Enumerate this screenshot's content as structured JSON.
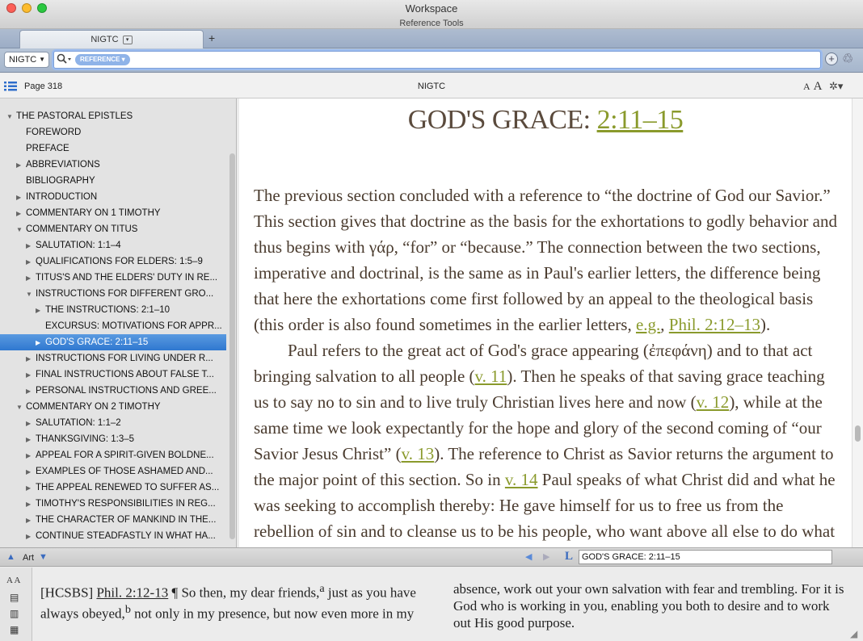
{
  "window": {
    "title": "Workspace",
    "subtitle": "Reference Tools"
  },
  "colors": {
    "accent": "#8a9a2c",
    "heading": "#5a4a3c",
    "selection": "#3b82d6"
  },
  "tab": {
    "label": "NIGTC",
    "menu_glyph": "▾",
    "add_glyph": "+"
  },
  "toolbar": {
    "resource": "NIGTC",
    "reference_pill": "REFERENCE ▾",
    "search_value": ""
  },
  "content_header": {
    "page": "Page 318",
    "resource_title": "NIGTC",
    "font_small": "A",
    "font_large": "A"
  },
  "toc": {
    "items": [
      {
        "label": "THE PASTORAL EPISTLES",
        "expander": "▼",
        "depth": 0
      },
      {
        "label": "FOREWORD",
        "expander": "",
        "depth": 1
      },
      {
        "label": "PREFACE",
        "expander": "",
        "depth": 1
      },
      {
        "label": "ABBREVIATIONS",
        "expander": "▶",
        "depth": 1
      },
      {
        "label": "BIBLIOGRAPHY",
        "expander": "",
        "depth": 1
      },
      {
        "label": "INTRODUCTION",
        "expander": "▶",
        "depth": 1
      },
      {
        "label": "COMMENTARY ON 1 TIMOTHY",
        "expander": "▶",
        "depth": 1
      },
      {
        "label": "COMMENTARY ON TITUS",
        "expander": "▼",
        "depth": 1
      },
      {
        "label": "SALUTATION: 1:1–4",
        "expander": "▶",
        "depth": 2
      },
      {
        "label": "QUALIFICATIONS FOR ELDERS: 1:5–9",
        "expander": "▶",
        "depth": 2
      },
      {
        "label": "TITUS'S AND THE ELDERS' DUTY IN RE...",
        "expander": "▶",
        "depth": 2
      },
      {
        "label": "INSTRUCTIONS FOR DIFFERENT GRO...",
        "expander": "▼",
        "depth": 2
      },
      {
        "label": "THE INSTRUCTIONS: 2:1–10",
        "expander": "▶",
        "depth": 3
      },
      {
        "label": "EXCURSUS: MOTIVATIONS FOR APPR...",
        "expander": "",
        "depth": 3
      },
      {
        "label": "GOD'S GRACE: 2:11–15",
        "expander": "▶",
        "depth": 3,
        "selected": true
      },
      {
        "label": "INSTRUCTIONS FOR LIVING UNDER R...",
        "expander": "▶",
        "depth": 2
      },
      {
        "label": "FINAL INSTRUCTIONS ABOUT FALSE T...",
        "expander": "▶",
        "depth": 2
      },
      {
        "label": "PERSONAL INSTRUCTIONS AND GREE...",
        "expander": "▶",
        "depth": 2
      },
      {
        "label": "COMMENTARY ON 2 TIMOTHY",
        "expander": "▼",
        "depth": 1
      },
      {
        "label": "SALUTATION: 1:1–2",
        "expander": "▶",
        "depth": 2
      },
      {
        "label": "THANKSGIVING: 1:3–5",
        "expander": "▶",
        "depth": 2
      },
      {
        "label": "APPEAL FOR A SPIRIT-GIVEN BOLDNE...",
        "expander": "▶",
        "depth": 2
      },
      {
        "label": "EXAMPLES OF THOSE ASHAMED AND...",
        "expander": "▶",
        "depth": 2
      },
      {
        "label": "THE APPEAL RENEWED TO SUFFER AS...",
        "expander": "▶",
        "depth": 2
      },
      {
        "label": "TIMOTHY'S RESPONSIBILITIES IN REG...",
        "expander": "▶",
        "depth": 2
      },
      {
        "label": "THE CHARACTER OF MANKIND IN THE...",
        "expander": "▶",
        "depth": 2
      },
      {
        "label": "CONTINUE STEADFASTLY IN WHAT HA...",
        "expander": "▶",
        "depth": 2
      }
    ]
  },
  "reader": {
    "heading_text": "GOD'S GRACE: ",
    "heading_link": "2:11–15",
    "p1": [
      {
        "t": "The previous section concluded with a reference to “the doctrine of God our Savior.” This section gives that doctrine as the basis for the exhortations to godly behavior and thus begins with γάρ, “for” or “because.” The connection between the two sections, imperative and doctrinal, is the same as in Paul's earlier letters, the difference being that here the exhortations come first followed by an appeal to the theological basis (this order is also found sometimes in the earlier letters, "
      },
      {
        "t": "e.g.",
        "link": true
      },
      {
        "t": ", "
      },
      {
        "t": "Phil. 2:12–13",
        "link": true
      },
      {
        "t": ")."
      }
    ],
    "p2": [
      {
        "t": "Paul refers to the great act of God's grace appearing (ἐπεφάνη) and to that act bringing salvation to all people ("
      },
      {
        "t": "v. 11",
        "link": true
      },
      {
        "t": "). Then he speaks of that saving grace teaching us to say no to sin and to live truly Christian lives here and now ("
      },
      {
        "t": "v. 12",
        "link": true
      },
      {
        "t": "), while at the same time we look expectantly for the hope and glory of the second coming of “our Savior Jesus Christ” ("
      },
      {
        "t": "v. 13",
        "link": true
      },
      {
        "t": "). The reference to Christ as Savior returns the argument to the major point of this section. So in "
      },
      {
        "t": "v. 14",
        "link": true
      },
      {
        "t": " Paul speaks of what Christ did and what he was seeking to accomplish thereby: He gave himself for us to free us from the rebellion of sin and to cleanse us to be his people, who want above all else to do what"
      }
    ]
  },
  "statusbar": {
    "art_label": "Art",
    "location": "GOD'S GRACE: 2:11–15",
    "link_glyph": "L"
  },
  "bottom_panel": {
    "tools_label": "A A",
    "segments": [
      {
        "t": "[HCSBS] "
      },
      {
        "t": "Phil. 2:12-13",
        "link": true
      },
      {
        "t": " ¶ So then, my dear friends,"
      },
      {
        "t": "a",
        "sup": true
      },
      {
        "t": " just as you have always obeyed,"
      },
      {
        "t": "b",
        "sup": true
      },
      {
        "t": " not only in my presence, but now even more in my absence, work out your own salvation with fear and trembling.  For it is God who is working in you, enabling you both to desire and to work out His good purpose."
      }
    ]
  }
}
